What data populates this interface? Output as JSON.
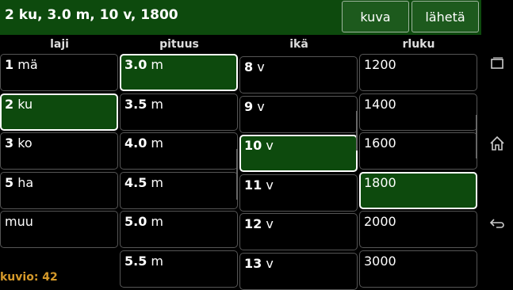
{
  "header": {
    "title": "2 ku, 3.0 m, 10 v, 1800",
    "buttons": {
      "kuva": "kuva",
      "laheta": "lähetä"
    }
  },
  "columns": [
    "laji",
    "pituus",
    "ikä",
    "rluku"
  ],
  "laji": [
    {
      "num": "1",
      "rest": " mä",
      "selected": false
    },
    {
      "num": "2",
      "rest": " ku",
      "selected": true
    },
    {
      "num": "3",
      "rest": " ko",
      "selected": false
    },
    {
      "num": "5",
      "rest": " ha",
      "selected": false
    },
    {
      "num": "",
      "rest": "muu",
      "selected": false
    }
  ],
  "pituus": [
    {
      "num": "3.0",
      "rest": " m",
      "selected": true
    },
    {
      "num": "3.5",
      "rest": " m",
      "selected": false
    },
    {
      "num": "4.0",
      "rest": " m",
      "selected": false
    },
    {
      "num": "4.5",
      "rest": " m",
      "selected": false
    },
    {
      "num": "5.0",
      "rest": " m",
      "selected": false
    },
    {
      "num": "5.5",
      "rest": " m",
      "selected": false
    }
  ],
  "ika": [
    {
      "num": "8",
      "rest": " v",
      "selected": false
    },
    {
      "num": "9",
      "rest": " v",
      "selected": false
    },
    {
      "num": "10",
      "rest": " v",
      "selected": true
    },
    {
      "num": "11",
      "rest": " v",
      "selected": false
    },
    {
      "num": "12",
      "rest": " v",
      "selected": false
    },
    {
      "num": "13",
      "rest": " v",
      "selected": false
    }
  ],
  "rluku": [
    {
      "num": "",
      "rest": "1200",
      "selected": false
    },
    {
      "num": "",
      "rest": "1400",
      "selected": false
    },
    {
      "num": "",
      "rest": "1600",
      "selected": false
    },
    {
      "num": "",
      "rest": "1800",
      "selected": true
    },
    {
      "num": "",
      "rest": "2000",
      "selected": false
    },
    {
      "num": "",
      "rest": "3000",
      "selected": false
    }
  ],
  "footer": {
    "label": "kuvio: 42"
  },
  "colors": {
    "header_bg": "#0d4a0d",
    "selected_bg": "#0d4a0d",
    "footer_text": "#d69a2a"
  },
  "nav_icons": [
    "recent-apps-icon",
    "home-icon",
    "back-icon"
  ]
}
